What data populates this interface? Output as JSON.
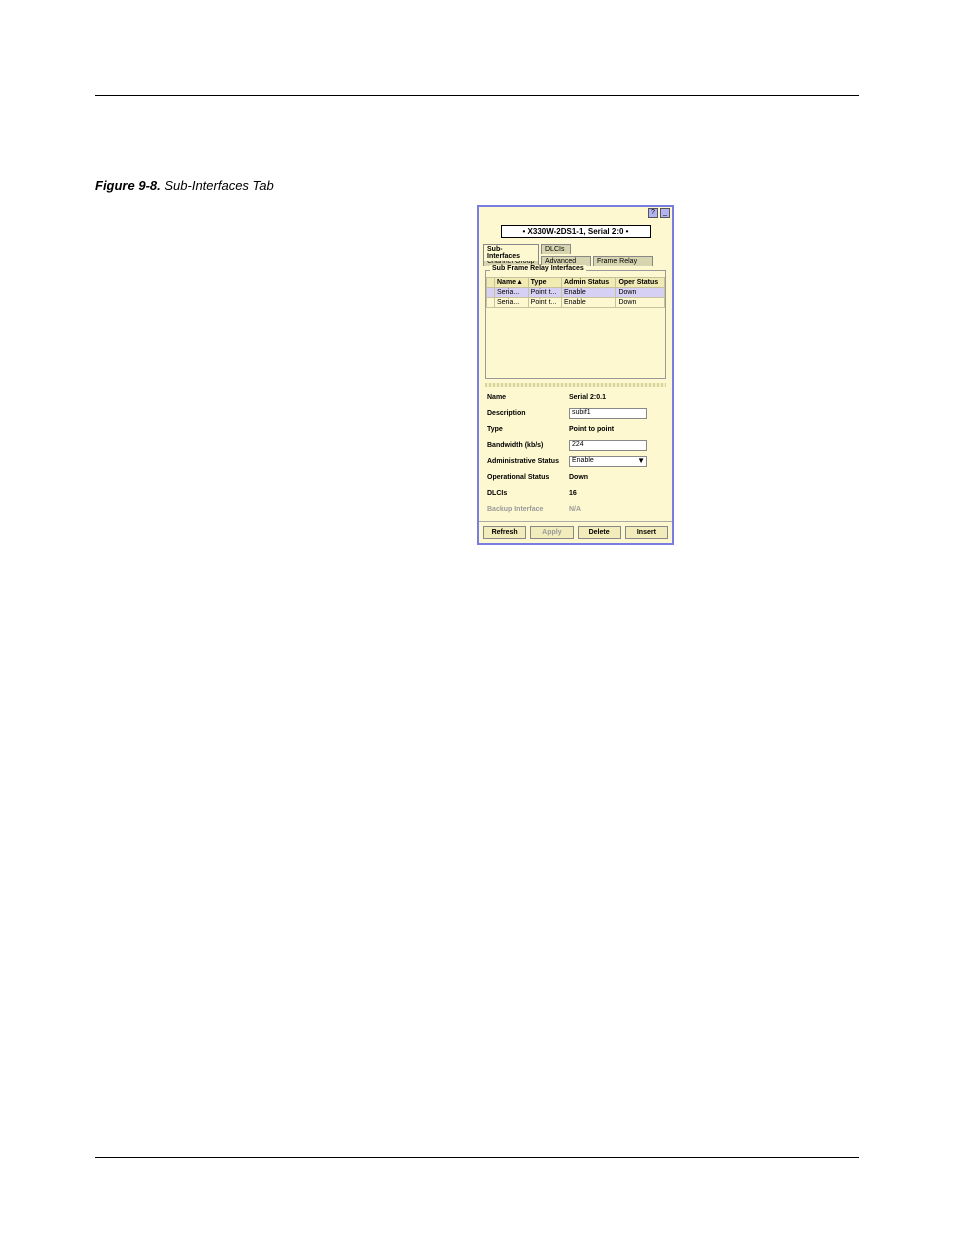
{
  "figure": {
    "label_prefix": "Figure 9-8.",
    "title": "Sub-Interfaces Tab"
  },
  "dialog": {
    "breadcrumb": "• X330W-2DS1-1, Serial 2:0 •",
    "tabs": {
      "sub_interfaces": "Sub-Interfaces",
      "dlcis": "DLCIs",
      "channel_group": "Channel Group",
      "advanced": "Advanced",
      "frame_relay": "Frame Relay"
    },
    "groupbox_label": "Sub Frame Relay Interfaces",
    "grid": {
      "headers": [
        "Name▲",
        "Type",
        "Admin Status",
        "Oper Status"
      ],
      "rows": [
        {
          "name": "Seria...",
          "type": "Point t...",
          "admin": "Enable",
          "oper": "Down"
        },
        {
          "name": "Seria...",
          "type": "Point t...",
          "admin": "Enable",
          "oper": "Down"
        }
      ]
    },
    "form": {
      "name": {
        "label": "Name",
        "value": "Serial 2:0.1"
      },
      "description": {
        "label": "Description",
        "value": "subif1"
      },
      "type": {
        "label": "Type",
        "value": "Point to point"
      },
      "bandwidth": {
        "label": "Bandwidth (kb/s)",
        "value": "224"
      },
      "admin_status": {
        "label": "Administrative Status",
        "value": "Enable"
      },
      "oper_status": {
        "label": "Operational Status",
        "value": "Down"
      },
      "dlcis": {
        "label": "DLCIs",
        "value": "16"
      },
      "backup": {
        "label": "Backup Interface",
        "value": "N/A"
      }
    },
    "buttons": {
      "refresh": "Refresh",
      "apply": "Apply",
      "delete": "Delete",
      "insert": "Insert"
    }
  }
}
